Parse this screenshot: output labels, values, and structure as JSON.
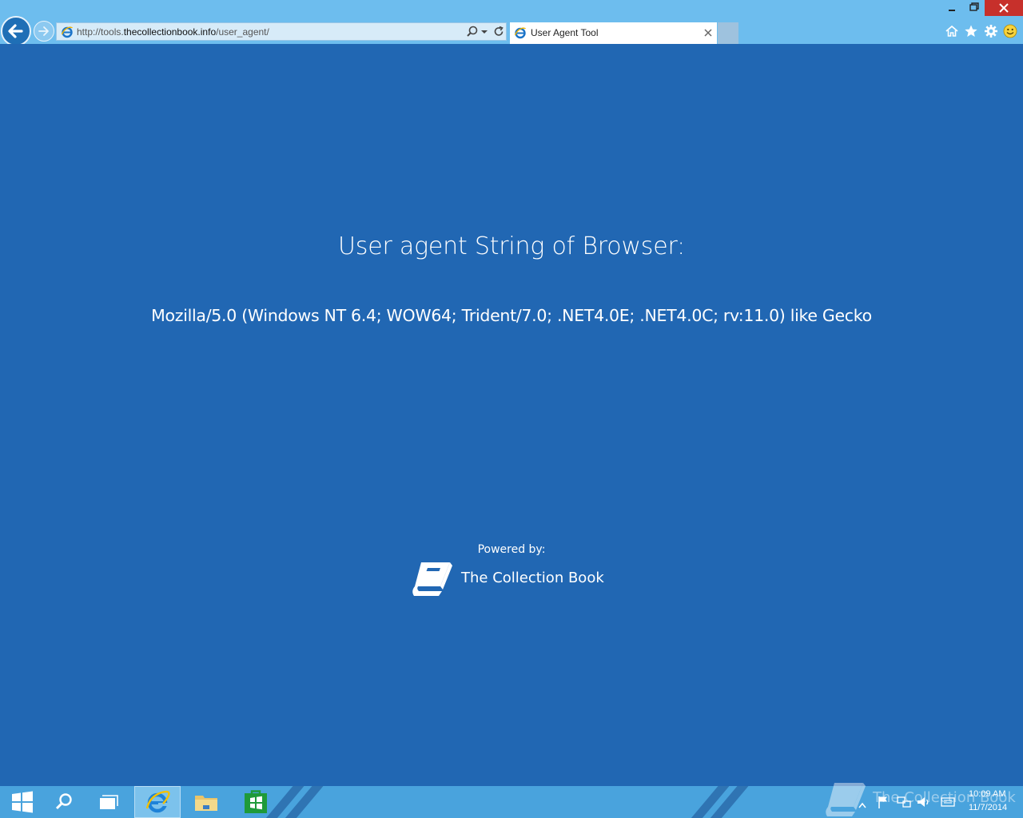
{
  "browser": {
    "address": {
      "prefix": "http://tools.",
      "domain": "thecollectionbook.info",
      "path": "/user_agent/"
    },
    "tab": {
      "title": "User Agent Tool"
    },
    "icons": [
      "back-arrow-icon",
      "forward-arrow-icon",
      "ie-favicon",
      "search-icon",
      "dropdown-arrow-icon",
      "refresh-icon",
      "close-icon",
      "home-icon",
      "favorites-star-icon",
      "gear-icon",
      "smiley-feedback-icon",
      "minimize-icon",
      "restore-icon",
      "window-close-icon"
    ]
  },
  "page": {
    "heading": "User agent String of Browser:",
    "user_agent": "Mozilla/5.0 (Windows NT 6.4; WOW64; Trident/7.0; .NET4.0E; .NET4.0C; rv:11.0) like Gecko",
    "powered_by_label": "Powered by:",
    "brand_name": "The Collection Book"
  },
  "taskbar": {
    "apps": [
      "start-windows-icon",
      "search-icon",
      "task-view-icon",
      "internet-explorer-icon",
      "file-explorer-icon",
      "store-icon"
    ],
    "clock": {
      "time": "10:09 AM",
      "date": "11/7/2014"
    },
    "watermark": "The Collection Book"
  },
  "colors": {
    "page_bg": "#2167b3",
    "chrome_bg": "#6dbdee",
    "taskbar_bg": "#49a3dd",
    "text": "#ffffff"
  }
}
